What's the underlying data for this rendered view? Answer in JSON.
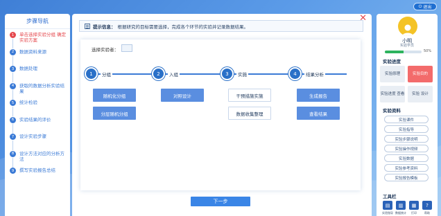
{
  "header": {
    "logout_label": "退出"
  },
  "steps": {
    "title": "步骤导航",
    "items": [
      {
        "num": "1",
        "label": "单击选择实验分组 确定实验方案"
      },
      {
        "num": "2",
        "label": "数据资料来源"
      },
      {
        "num": "3",
        "label": "数据处理"
      },
      {
        "num": "4",
        "label": "获取的数据分析实验结果"
      },
      {
        "num": "5",
        "label": "统计检验"
      },
      {
        "num": "6",
        "label": "实验结果的评价"
      },
      {
        "num": "7",
        "label": "设计实验步骤"
      },
      {
        "num": "8",
        "label": "设计方法对应的分析方法"
      },
      {
        "num": "9",
        "label": "撰写实验报告总结"
      }
    ]
  },
  "notice": {
    "label": "提示信息：",
    "text": "根据研究的目标需要选择，完成各个环节的实验并记录数据结果。"
  },
  "work": {
    "select_label": "选择实验者：",
    "nodes": [
      {
        "num": "1",
        "label": "分组"
      },
      {
        "num": "2",
        "label": "入组"
      },
      {
        "num": "3",
        "label": "实施"
      },
      {
        "num": "4",
        "label": "结果分析"
      }
    ],
    "buttons": {
      "b1": "随机化分组",
      "b2": "分层随机分组",
      "b3": "对照设计",
      "b4": "干预措施实施",
      "b5": "数据收集整理",
      "b6": "生成报告",
      "b7": "查看结果"
    },
    "next_label": "下一步"
  },
  "user": {
    "name": "小明",
    "role": "实验学员",
    "progress_percent": 50,
    "progress_text": "50%"
  },
  "sections": {
    "quick": "实验进度",
    "menu": "实验资料",
    "tools": "工具栏"
  },
  "tiles": [
    {
      "label": "实验原理"
    },
    {
      "label": "实验目的"
    },
    {
      "label": "实验进度 查看"
    },
    {
      "label": "实验 设计"
    }
  ],
  "tool_items": [
    "实验课件",
    "实验指导",
    "实验步骤说明",
    "实验操作视频",
    "实验数据",
    "实验参考资料",
    "实验报告模板"
  ],
  "tool_icons": [
    {
      "icon": "book-icon",
      "label": "实验指导"
    },
    {
      "icon": "chart-icon",
      "label": "数据统计"
    },
    {
      "icon": "printer-icon",
      "label": "打印"
    },
    {
      "icon": "help-icon",
      "label": "帮助"
    }
  ]
}
